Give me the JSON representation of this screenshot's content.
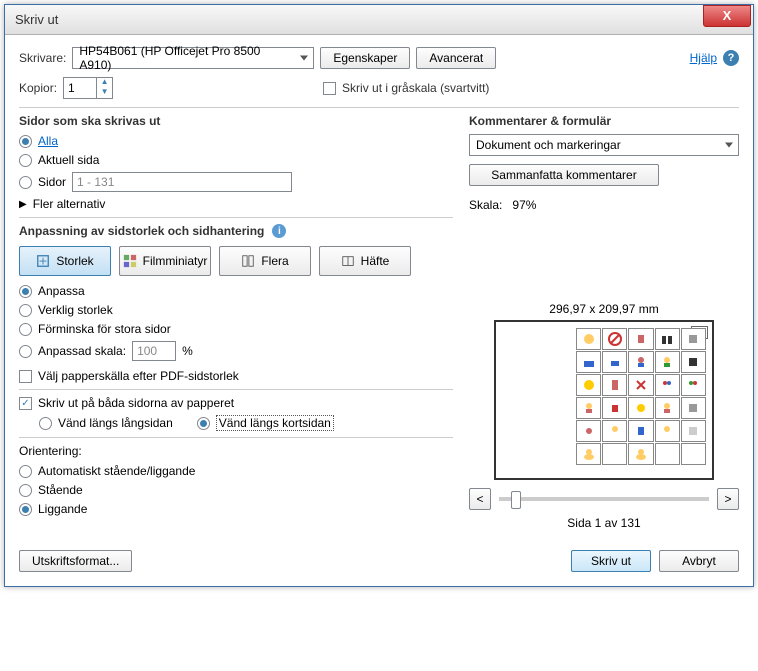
{
  "titlebar": {
    "title": "Skriv ut"
  },
  "top": {
    "printer_label": "Skrivare:",
    "printer_value": "HP54B061 (HP Officejet Pro 8500 A910)",
    "properties_btn": "Egenskaper",
    "advanced_btn": "Avancerat",
    "help_link": "Hjälp",
    "copies_label": "Kopior:",
    "copies_value": "1",
    "grayscale_label": "Skriv ut i gråskala (svartvitt)"
  },
  "pages": {
    "title": "Sidor som ska skrivas ut",
    "all": "Alla",
    "current": "Aktuell sida",
    "range_label": "Sidor",
    "range_value": "1 - 131",
    "more": "Fler alternativ"
  },
  "sizing": {
    "title": "Anpassning av sidstorlek och sidhantering",
    "size_btn": "Storlek",
    "thumb_btn": "Filmminiatyr",
    "multi_btn": "Flera",
    "booklet_btn": "Häfte",
    "fit": "Anpassa",
    "actual": "Verklig storlek",
    "shrink": "Förminska för stora sidor",
    "custom_label": "Anpassad skala:",
    "custom_value": "100",
    "percent": "%",
    "paper_source": "Välj papperskälla efter PDF-sidstorlek"
  },
  "duplex": {
    "print_both": "Skriv ut på båda sidorna av papperet",
    "long_edge": "Vänd längs långsidan",
    "short_edge": "Vänd längs kortsidan"
  },
  "orientation": {
    "title": "Orientering:",
    "auto": "Automatiskt stående/liggande",
    "portrait": "Stående",
    "landscape": "Liggande"
  },
  "comments": {
    "title": "Kommentarer & formulär",
    "option": "Dokument och markeringar",
    "summarize_btn": "Sammanfatta kommentarer"
  },
  "preview": {
    "scale_label": "Skala:",
    "scale_value": "97%",
    "dimensions": "296,97 x 209,97 mm",
    "page_label": "1a",
    "page_nav": "Sida 1 av 131",
    "prev": "<",
    "next": ">"
  },
  "bottom": {
    "page_setup": "Utskriftsformat...",
    "print": "Skriv ut",
    "cancel": "Avbryt"
  }
}
